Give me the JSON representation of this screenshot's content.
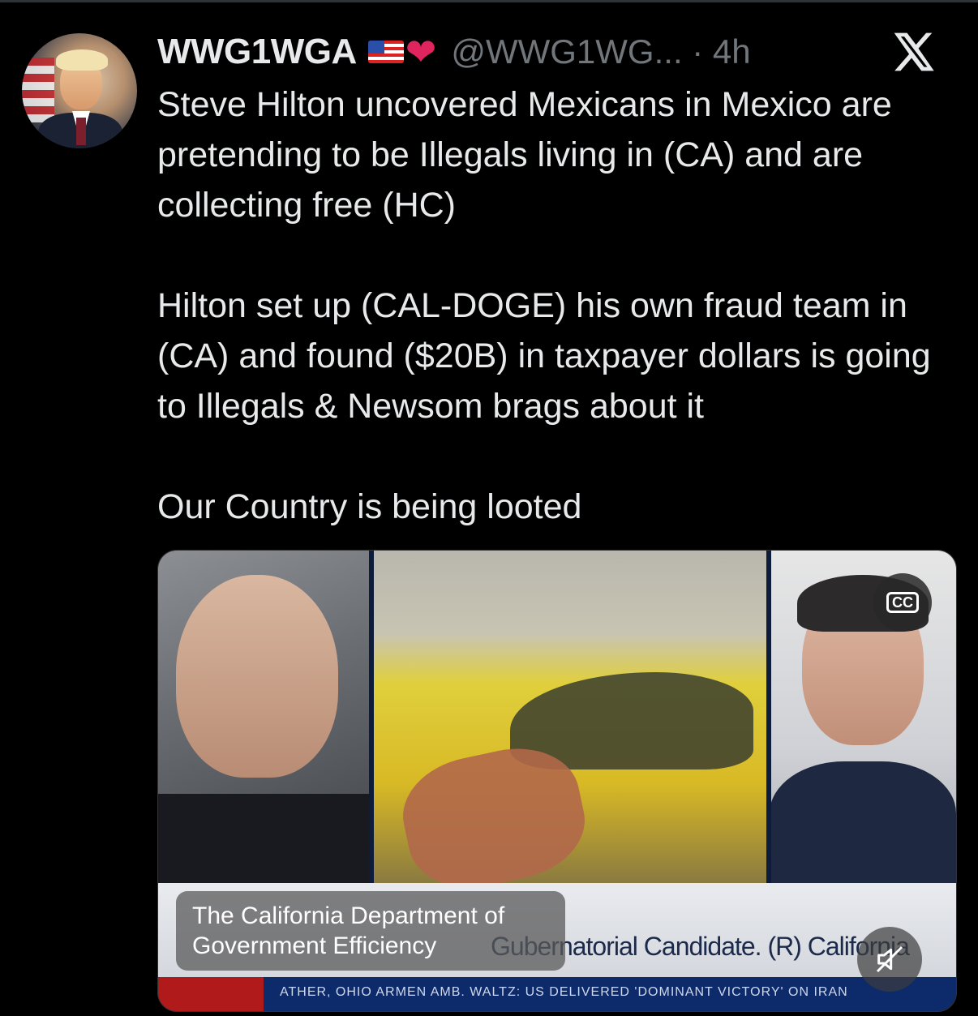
{
  "author": {
    "display_name": "WWG1WGA",
    "handle_and_time": "@WWG1WG... · 4h"
  },
  "tweet": {
    "paragraphs": [
      "Steve Hilton uncovered Mexicans in Mexico are pretending to be Illegals living in (CA) and are collecting free (HC)",
      "Hilton set up (CAL-DOGE) his own fraud team in (CA) and found ($20B) in taxpayer dollars is going to Illegals & Newsom brags about it",
      "Our Country is being looted"
    ]
  },
  "media": {
    "caption": "The California Department of Government Efficiency",
    "cc_label": "CC",
    "chyron": "Gubernatorial Candidate. (R) California",
    "ticker": "ATHER, OHIO ARMEN     AMB. WALTZ: US DELIVERED 'DOMINANT VICTORY' ON IRAN"
  },
  "icons": {
    "brand": "x-logo-icon",
    "cc": "closed-captions-icon",
    "mute": "muted-speaker-icon",
    "heart_color": "#e0245e"
  }
}
